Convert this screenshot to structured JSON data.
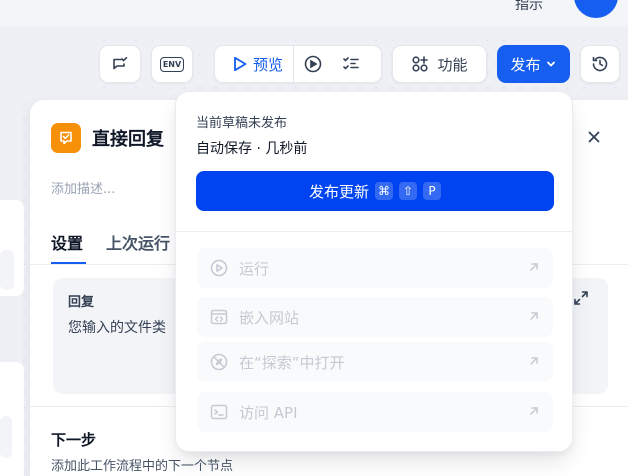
{
  "header": {
    "partial_text": "指示",
    "avatar_color": "#155eef"
  },
  "toolbar": {
    "env_label": "ENV",
    "preview_label": "预览",
    "features_label": "功能",
    "publish_label": "发布"
  },
  "panel": {
    "title": "直接回复",
    "description_placeholder": "添加描述...",
    "tabs": [
      {
        "label": "设置",
        "active": true
      },
      {
        "label": "上次运行",
        "active": false
      }
    ],
    "reply": {
      "label": "回复",
      "text": "您输入的文件类"
    },
    "next": {
      "title": "下一步",
      "description": "添加此工作流程中的下一个节点"
    }
  },
  "dropdown": {
    "status": "当前草稿未发布",
    "autosave": "自动保存 · 几秒前",
    "publish_button": "发布更新",
    "shortcut_keys": [
      "⌘",
      "⇧",
      "P"
    ],
    "items": [
      {
        "label": "运行",
        "icon": "play-circle-icon"
      },
      {
        "label": "嵌入网站",
        "icon": "embed-icon"
      },
      {
        "label": "在“探索”中打开",
        "icon": "compass-icon"
      },
      {
        "label": "访问 API",
        "icon": "terminal-icon"
      }
    ]
  },
  "colors": {
    "accent": "#155eef",
    "publish_button": "#0044f1",
    "node_icon": "#f79009"
  }
}
